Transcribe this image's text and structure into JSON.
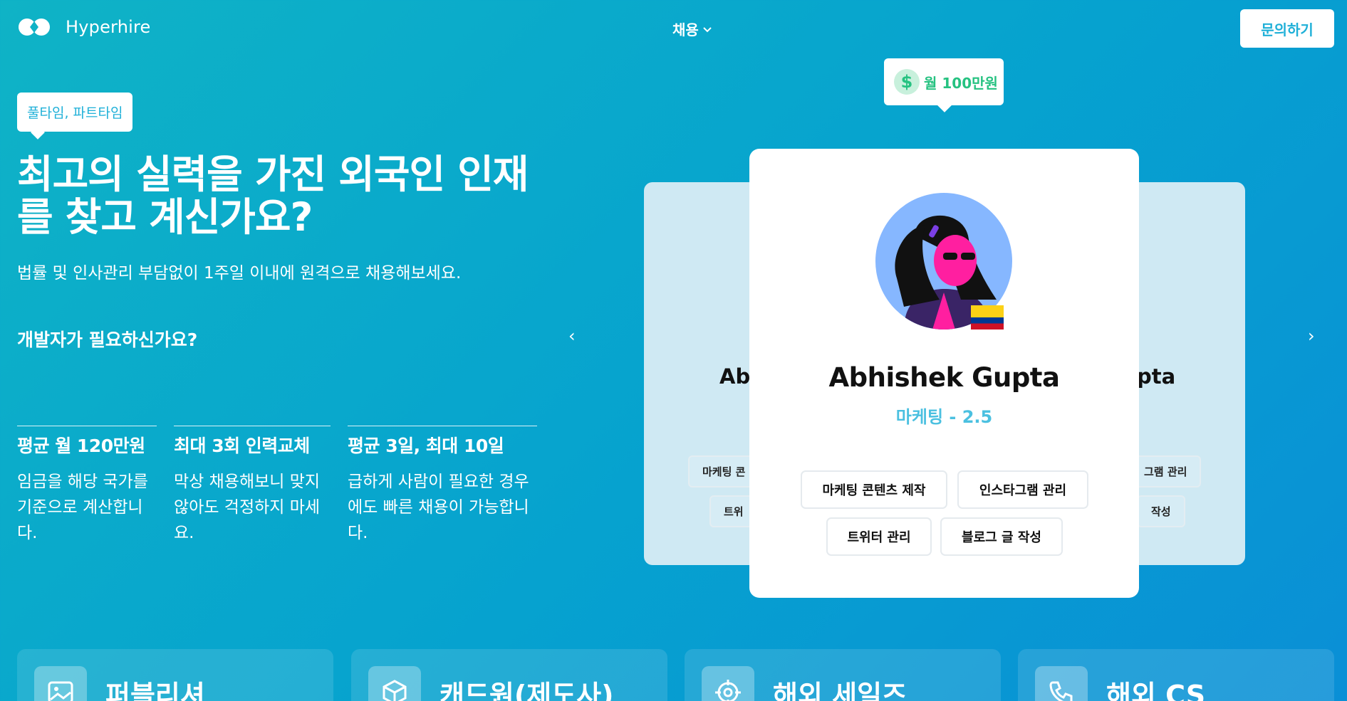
{
  "header": {
    "brand": "Hyperhire",
    "nav_recruit": "채용",
    "contact_label": "문의하기"
  },
  "hero": {
    "pill": "풀타임, 파트타임",
    "title": "최고의 실력을 가진 외국인 인재를 찾고 계신가요?",
    "subtitle": "법률 및 인사관리 부담없이 1주일 이내에 원격으로 채용해보세요.",
    "dev_question": "개발자가 필요하신가요?"
  },
  "stats": [
    {
      "title": "평균 월 120만원",
      "desc": "임금을 해당 국가를 기준으로 계산합니다."
    },
    {
      "title": "최대 3회 인력교체",
      "desc": "막상 채용해보니 맞지 않아도 걱정하지 마세요."
    },
    {
      "title": "평균 3일, 최대 10일",
      "desc": "급하게 사람이 필요한 경우에도 빠른 채용이 가능합니다."
    }
  ],
  "carousel": {
    "prev": "‹",
    "next": "›",
    "salary_badge": "월 100만원",
    "dollar_symbol": "$",
    "left_card": {
      "name_visible": "Ab",
      "tags_visible": [
        "마케팅 콘",
        "트위"
      ]
    },
    "right_card": {
      "name_visible": "pta",
      "tags_visible": [
        "그램 관리",
        "작성"
      ]
    },
    "main_card": {
      "name": "Abhishek Gupta",
      "role": "마케팅 - 2.5",
      "skills": [
        "마케팅 콘텐츠 제작",
        "인스타그램 관리",
        "트위터 관리",
        "블로그 글 작성"
      ]
    }
  },
  "jobs": [
    {
      "title": "퍼블리셔",
      "icon": "image-icon"
    },
    {
      "title": "캐드원(제도사)",
      "icon": "box-icon"
    },
    {
      "title": "해외 세일즈",
      "icon": "target-icon"
    },
    {
      "title": "해외 CS",
      "icon": "phone-icon"
    }
  ],
  "colors": {
    "accent_text": "#1fb0d8",
    "salary_green": "#26c281",
    "role_blue": "#4bc0e0"
  }
}
